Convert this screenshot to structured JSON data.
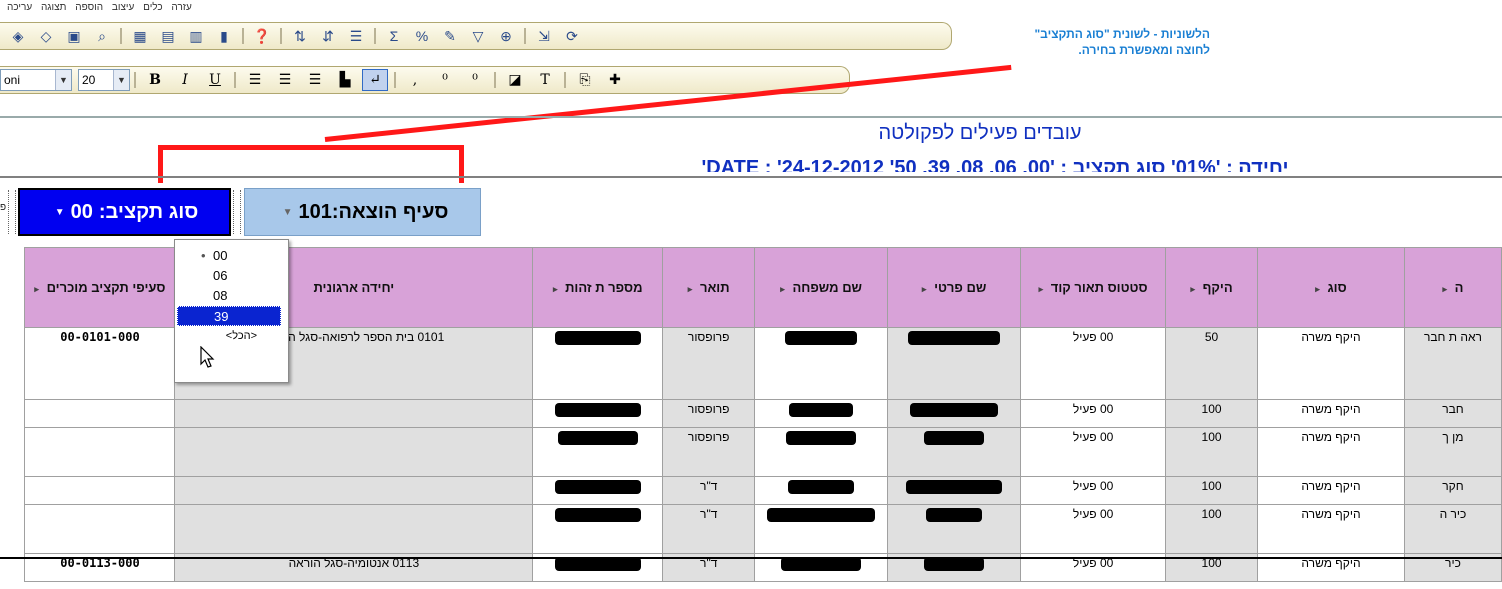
{
  "menubar": {
    "items": [
      "עזרה",
      "כלים",
      "עיצוב",
      "הוספה",
      "תצוגה",
      "עריכה"
    ]
  },
  "format_toolbar": {
    "font_name": "oni",
    "font_size": "20"
  },
  "callout": {
    "text": "הלשוניות - לשונית \"סוג התקציב\" לחוצה ומאפשרת בחירה."
  },
  "report": {
    "title": "עובדים פעילים לפקולטה",
    "subtitle": "יחידה : '01%'   סוג תקציב : '00, 06, 08, 39, 50'   DATE : '24-12-2012'"
  },
  "page_fields": {
    "left_label": "פ",
    "budget_type": {
      "label": "סוג תקציב:",
      "value": "00"
    },
    "expense_item": {
      "label": "סעיף הוצאה:",
      "value": "101"
    }
  },
  "dropdown": {
    "items": [
      "00",
      "06",
      "08",
      "39"
    ],
    "selected": "39",
    "all_label": "<הכל>"
  },
  "grid": {
    "headers": [
      "סעיפי תקציב מוכרים",
      "יחידה ארגונית",
      "מספר ת זהות",
      "תואר",
      "שם משפחה",
      "שם פרטי",
      "סטטוס תאור קוד",
      "היקף",
      "סוג",
      "ה"
    ],
    "rows": [
      {
        "code": "00-0101-000",
        "unit": "0101 בית הספר לרפואה-סגל הוראה",
        "title": "פרופסור",
        "status": "00 פעיל",
        "scope": "50",
        "type": "היקף משרה",
        "rank": "ראה ת חבר"
      },
      {
        "code": "",
        "unit": "",
        "title": "פרופסור",
        "status": "00 פעיל",
        "scope": "100",
        "type": "היקף משרה",
        "rank": "חבר"
      },
      {
        "code": "",
        "unit": "",
        "title": "פרופסור",
        "status": "00 פעיל",
        "scope": "100",
        "type": "היקף משרה",
        "rank": "מן ך"
      },
      {
        "code": "",
        "unit": "",
        "title": "ד\"ר",
        "status": "00 פעיל",
        "scope": "100",
        "type": "היקף משרה",
        "rank": "חקר"
      },
      {
        "code": "",
        "unit": "",
        "title": "ד\"ר",
        "status": "00 פעיל",
        "scope": "100",
        "type": "היקף משרה",
        "rank": "כיר ה"
      },
      {
        "code": "00-0113-000",
        "unit": "0113 אנטומיה-סגל הוראה",
        "title": "ד\"ר",
        "status": "00 פעיל",
        "scope": "100",
        "type": "היקף משרה",
        "rank": "כיר"
      }
    ]
  },
  "colors": {
    "header_bg": "#d8a2d8",
    "selected_field": "#0000f0",
    "expense_field": "#a8c8ea",
    "annotation": "#ff1818",
    "callout_text": "#1a7fd3"
  }
}
